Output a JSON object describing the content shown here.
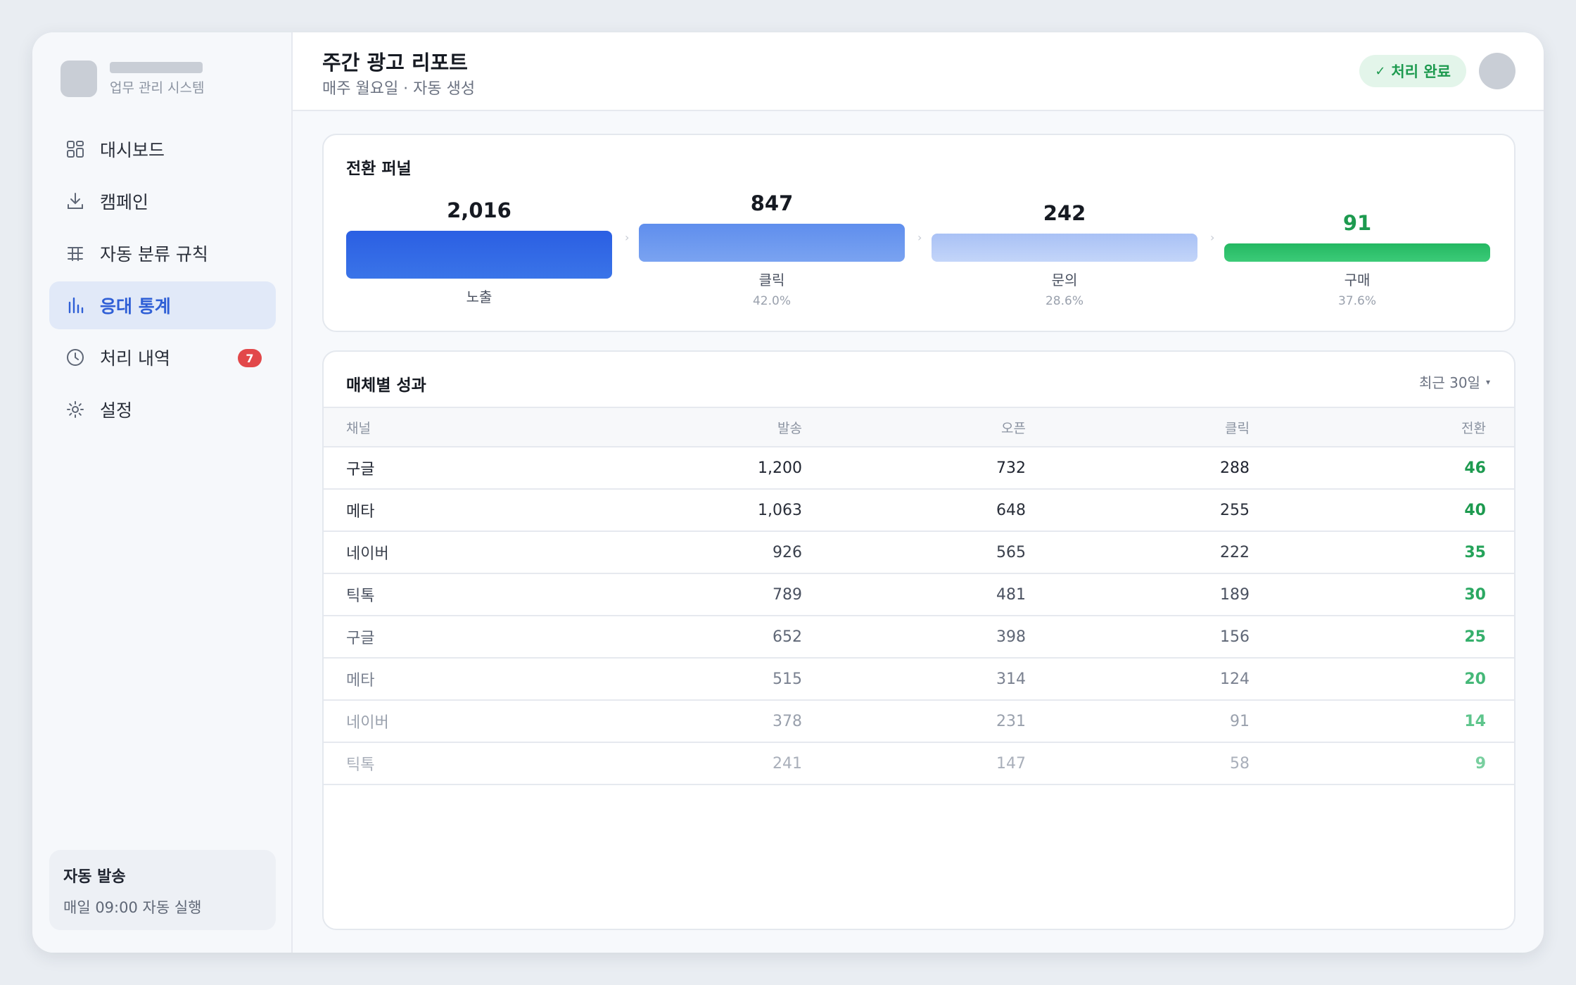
{
  "brand": {
    "subtitle": "업무 관리 시스템"
  },
  "sidebar": {
    "items": [
      {
        "label": "대시보드",
        "icon": "grid-icon"
      },
      {
        "label": "캠페인",
        "icon": "download-icon"
      },
      {
        "label": "자동 분류 규칙",
        "icon": "table-icon"
      },
      {
        "label": "응대 통계",
        "icon": "bar-chart-icon",
        "active": true
      },
      {
        "label": "처리 내역",
        "icon": "clock-icon",
        "badge": "7"
      },
      {
        "label": "설정",
        "icon": "gear-icon"
      }
    ],
    "auto_card": {
      "title": "자동 발송",
      "subtitle": "매일 09:00 자동 실행"
    }
  },
  "header": {
    "title": "주간 광고 리포트",
    "subtitle": "매주 월요일 · 자동 생성",
    "status": "처리 완료",
    "status_check": "✓"
  },
  "funnel": {
    "title": "전환 퍼널",
    "stages": [
      {
        "value": "2,016",
        "label": "노출",
        "pct": "",
        "color": "#2f63e0"
      },
      {
        "value": "847",
        "label": "클릭",
        "pct": "42.0%",
        "color": "#6a98ef"
      },
      {
        "value": "242",
        "label": "문의",
        "pct": "28.6%",
        "color": "#b4cbf7"
      },
      {
        "value": "91",
        "label": "구매",
        "pct": "37.6%",
        "color": "#2bbd68"
      }
    ]
  },
  "table": {
    "title": "매체별 성과",
    "filter": "최근 30일",
    "columns": [
      "채널",
      "발송",
      "오픈",
      "클릭",
      "전환"
    ],
    "rows": [
      [
        "구글",
        "1,200",
        "732",
        "288",
        "46"
      ],
      [
        "메타",
        "1,063",
        "648",
        "255",
        "40"
      ],
      [
        "네이버",
        "926",
        "565",
        "222",
        "35"
      ],
      [
        "틱톡",
        "789",
        "481",
        "189",
        "30"
      ],
      [
        "구글",
        "652",
        "398",
        "156",
        "25"
      ],
      [
        "메타",
        "515",
        "314",
        "124",
        "20"
      ],
      [
        "네이버",
        "378",
        "231",
        "91",
        "14"
      ],
      [
        "틱톡",
        "241",
        "147",
        "58",
        "9"
      ]
    ]
  },
  "colors": {
    "accent": "#2f5fd6",
    "success": "#1d9a4f",
    "danger": "#e2484a"
  }
}
